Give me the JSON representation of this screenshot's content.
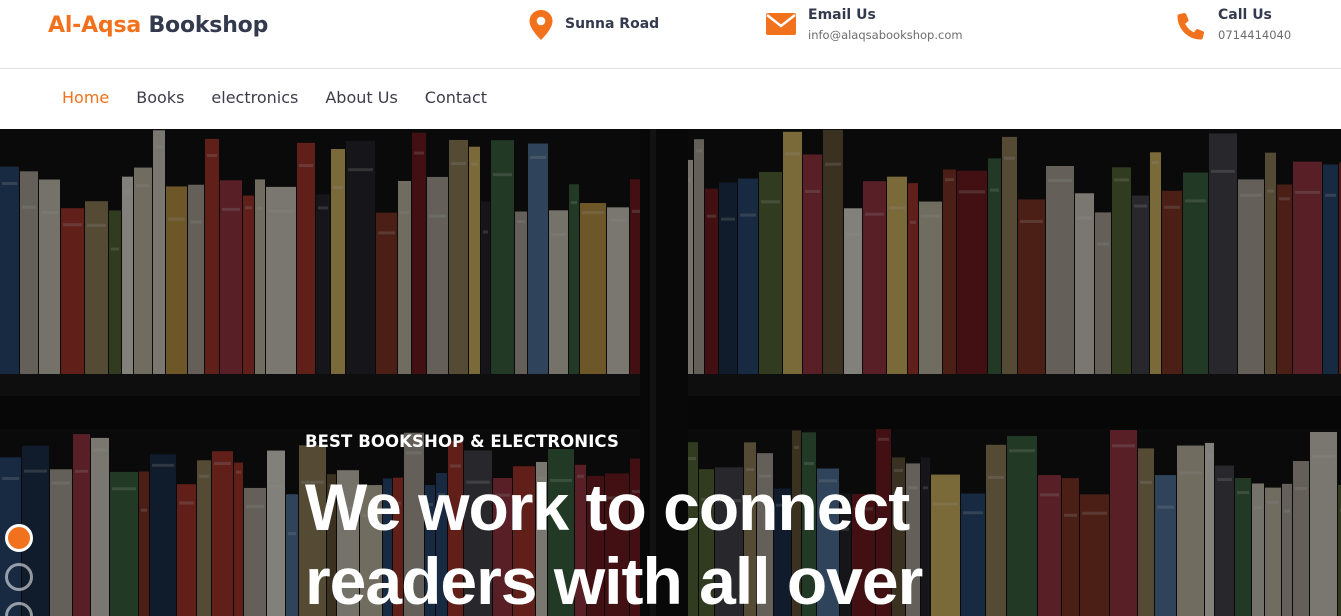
{
  "brand": {
    "part1": "Al-Aqsa",
    "part2": "Bookshop",
    "accent": "#f2711c",
    "dark": "#343a4e"
  },
  "contact": {
    "location": {
      "icon": "map-pin-icon",
      "title": "Sunna Road"
    },
    "email": {
      "icon": "envelope-icon",
      "title": "Email Us",
      "value": "info@alaqsabookshop.com"
    },
    "phone": {
      "icon": "phone-icon",
      "title": "Call Us",
      "value": "0714414040"
    }
  },
  "nav": {
    "items": [
      {
        "label": "Home",
        "active": true
      },
      {
        "label": "Books"
      },
      {
        "label": "electronics"
      },
      {
        "label": "About Us"
      },
      {
        "label": "Contact"
      }
    ]
  },
  "hero": {
    "eyebrow": "BEST BOOKSHOP & ELECTRONICS",
    "headline_line1": "We work to connect",
    "headline_line2": "readers with all over",
    "slide_active": 1
  }
}
